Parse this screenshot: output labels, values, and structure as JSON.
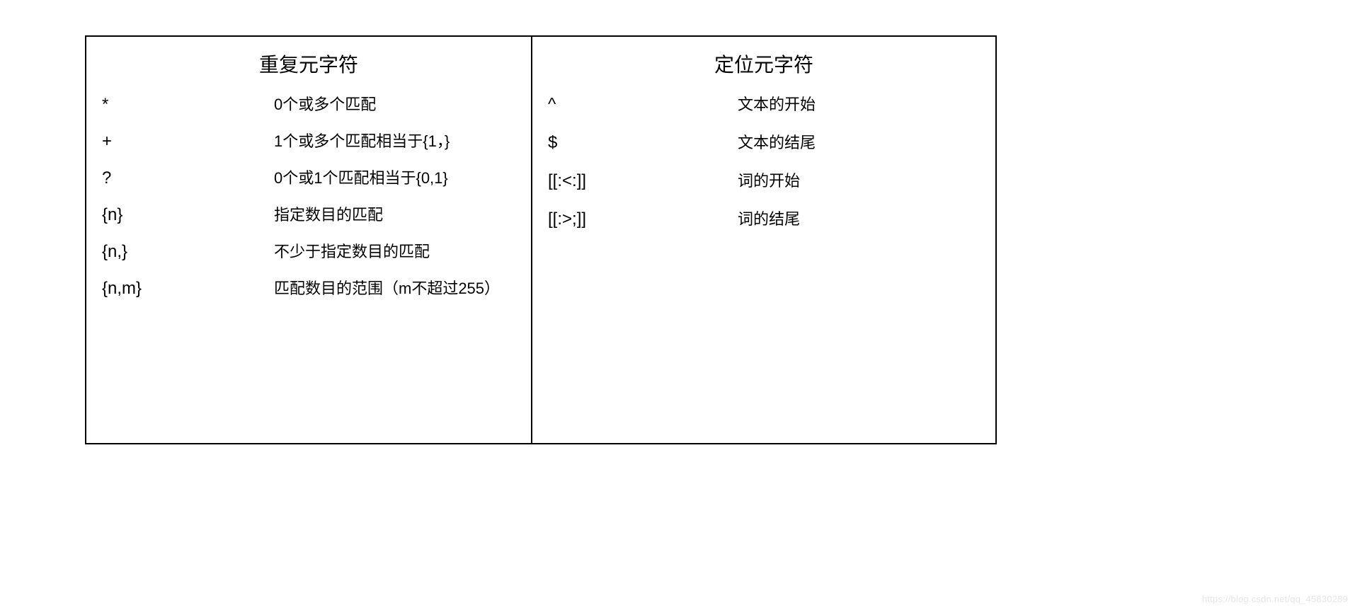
{
  "left": {
    "title": "重复元字符",
    "rows": [
      {
        "sym": "*",
        "desc": "0个或多个匹配"
      },
      {
        "sym": "+",
        "desc": "1个或多个匹配相当于{1，}"
      },
      {
        "sym": "?",
        "desc": "0个或1个匹配相当于{0,1}"
      },
      {
        "sym": "{n}",
        "desc": "指定数目的匹配"
      },
      {
        "sym": "{n,}",
        "desc": "不少于指定数目的匹配"
      },
      {
        "sym": "{n,m}",
        "desc": "匹配数目的范围（m不超过255）"
      }
    ]
  },
  "right": {
    "title": "定位元字符",
    "rows": [
      {
        "sym": "^",
        "desc": "文本的开始"
      },
      {
        "sym": "$",
        "desc": "文本的结尾"
      },
      {
        "sym": "[[:<:]]",
        "desc": "词的开始"
      },
      {
        "sym": "[[:>;]]",
        "desc": "词的结尾"
      }
    ]
  },
  "watermark": "https://blog.csdn.net/qq_45830289"
}
